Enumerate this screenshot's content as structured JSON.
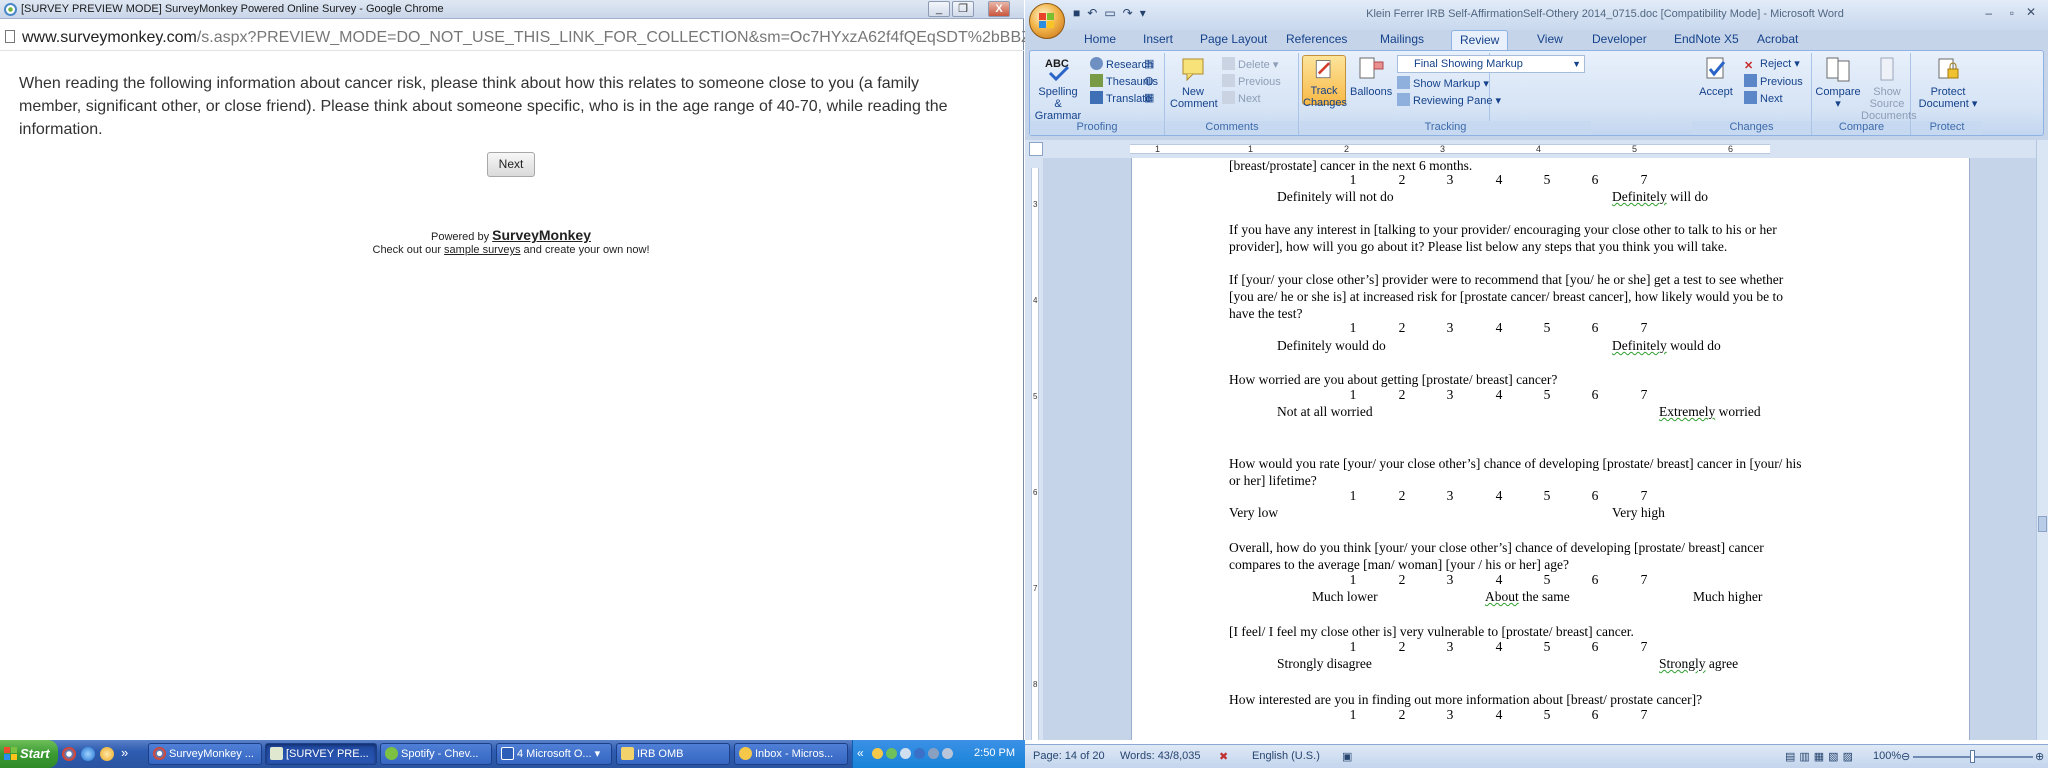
{
  "chrome": {
    "title": "[SURVEY PREVIEW MODE] SurveyMonkey Powered Online Survey - Google Chrome",
    "url_domain": "www.surveymonkey.com",
    "url_rest": "/s.aspx?PREVIEW_MODE=DO_NOT_USE_THIS_LINK_FOR_COLLECTION&sm=Oc7HYxzA62f4fQEqSDT%2bBBZ3U",
    "survey_text": "When reading the following information about cancer risk, please think about how this relates to someone close to you (a family member, significant other, or close friend). Please think about someone specific, who is in the age range of 40-70, while reading the information.",
    "next_label": "Next",
    "powered_by": "Powered by",
    "brand": "SurveyMonkey",
    "checkout_pre": "Check out our",
    "checkout_link": "sample surveys",
    "checkout_post": "and create your own now!",
    "win_min": "_",
    "win_max": "❐",
    "win_close": "X"
  },
  "word": {
    "title": "Klein Ferrer IRB Self-AffirmationSelf-Othery 2014_0715.doc [Compatibility Mode] - Microsoft Word",
    "tabs": [
      "Home",
      "Insert",
      "Page Layout",
      "References",
      "Mailings",
      "Review",
      "View",
      "Developer",
      "EndNote X5",
      "Acrobat"
    ],
    "active_tab": "Review",
    "ribbon": {
      "proofing": {
        "label": "Proofing",
        "spelling": "Spelling &",
        "grammar": "Grammar",
        "research": "Research",
        "thesaurus": "Thesaurus",
        "translate": "Translate"
      },
      "comments": {
        "label": "Comments",
        "new": "New",
        "comment": "Comment",
        "delete": "Delete",
        "previous": "Previous",
        "next": "Next"
      },
      "tracking": {
        "label": "Tracking",
        "track": "Track",
        "changes": "Changes",
        "balloons": "Balloons",
        "markup_mode": "Final Showing Markup",
        "show_markup": "Show Markup",
        "reviewing_pane": "Reviewing Pane"
      },
      "changes": {
        "label": "Changes",
        "accept": "Accept",
        "reject": "Reject",
        "previous": "Previous",
        "next": "Next"
      },
      "compare": {
        "label": "Compare",
        "compare": "Compare",
        "show_source": "Show Source",
        "documents": "Documents"
      },
      "protect": {
        "label": "Protect",
        "protect": "Protect",
        "document": "Document"
      }
    },
    "ruler_numbers": [
      "1",
      "1",
      "2",
      "3",
      "4",
      "5",
      "6"
    ],
    "vruler_numbers": [
      "3",
      "4",
      "5",
      "6",
      "7",
      "8"
    ],
    "doc": {
      "l1": "[breast/prostate] cancer in the next 6 months.",
      "scale": [
        "1",
        "2",
        "3",
        "4",
        "5",
        "6",
        "7"
      ],
      "q1_low": "Definitely will not do",
      "q1_high_sp": "Definitely",
      "q1_high_rest": " will do",
      "q2_l1": "If you have any interest in [talking to your provider/ encouraging your close other to talk to his or her",
      "q2_l2": "provider], how will you go about it? Please list below any steps that you think you will take.",
      "q3_l1": "If [your/ your close other’s] provider were to recommend that [you/ he or she] get a test to see whether",
      "q3_l2": "[you are/ he or she is] at increased risk for [prostate cancer/ breast cancer], how likely would you be to",
      "q3_l3": "have the test?",
      "q3_low": "Definitely would do",
      "q3_high_sp": "Definitely",
      "q3_high_rest": " would do",
      "q4": "How worried are you about getting [prostate/ breast] cancer?",
      "q4_low": "Not at all worried",
      "q4_high_sp": "Extremely",
      "q4_high_rest": " worried",
      "q5_l1": "How would you rate [your/ your close other’s] chance of developing [prostate/ breast] cancer in [your/ his",
      "q5_l2": "or her] lifetime?",
      "q5_low": "Very low",
      "q5_high": "Very high",
      "q6_l1": "Overall, how do you think [your/ your close other’s] chance of developing [prostate/ breast] cancer",
      "q6_l2": "compares to the average [man/ woman] [your / his or her] age?",
      "q6_low": "Much lower",
      "q6_mid_sp": "About",
      "q6_mid_rest": " the same",
      "q6_high": "Much higher",
      "q7": "[I feel/ I feel my close other is] very vulnerable to [prostate/ breast] cancer.",
      "q7_low": "Strongly disagree",
      "q7_high_sp": "Strongly",
      "q7_high_rest": " agree",
      "q8": "How interested are you in finding out more information about [breast/ prostate cancer]?"
    },
    "status": {
      "page": "Page: 14 of 20",
      "words": "Words: 43/8,035",
      "language": "English (U.S.)",
      "zoom": "100%"
    }
  },
  "taskbar": {
    "start": "Start",
    "more": "»",
    "buttons": [
      "SurveyMonkey ...",
      "[SURVEY PRE...",
      "Spotify - Chev...",
      "4 Microsoft O...",
      "IRB OMB",
      "Inbox - Micros..."
    ],
    "active_index": 1,
    "tray_more": "«",
    "clock": "2:50 PM"
  },
  "colors": {
    "chrome_blue": "#4a87c8",
    "office_orange": "#f2b54a",
    "xp_green": "#3b9a32",
    "xp_blue": "#2e5cb0"
  }
}
